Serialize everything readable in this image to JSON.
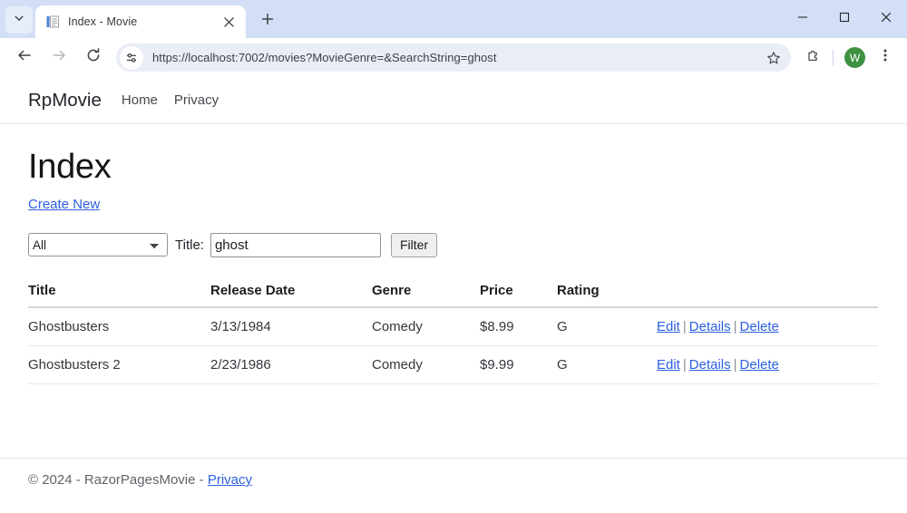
{
  "browser": {
    "tab": {
      "title": "Index - Movie",
      "favicon_icon": "document-icon",
      "close_icon": "close-icon"
    },
    "tablist_dropdown_icon": "chevron-down-icon",
    "new_tab_icon": "plus-icon",
    "window_controls": {
      "minimize_icon": "minimize-icon",
      "maximize_icon": "maximize-icon",
      "close_icon": "close-icon"
    },
    "toolbar": {
      "back_icon": "arrow-left-icon",
      "forward_icon": "arrow-right-icon",
      "reload_icon": "reload-icon",
      "site_settings_icon": "tune-icon",
      "url": "https://localhost:7002/movies?MovieGenre=&SearchString=ghost",
      "bookmark_icon": "star-icon",
      "extensions_icon": "puzzle-piece-icon",
      "profile_initial": "W",
      "menu_icon": "three-dots-vertical-icon"
    }
  },
  "page": {
    "navbar": {
      "brand": "RpMovie",
      "links": [
        {
          "label": "Home"
        },
        {
          "label": "Privacy"
        }
      ]
    },
    "title": "Index",
    "create_new_label": "Create New",
    "filter": {
      "genre_selected": "All",
      "genre_options": [
        "All"
      ],
      "title_label": "Title:",
      "search_value": "ghost",
      "search_placeholder": "",
      "filter_button": "Filter"
    },
    "table": {
      "columns": [
        "Title",
        "Release Date",
        "Genre",
        "Price",
        "Rating"
      ],
      "actions": {
        "edit": "Edit",
        "details": "Details",
        "delete": "Delete",
        "separator": "|"
      },
      "rows": [
        {
          "title": "Ghostbusters",
          "release_date": "3/13/1984",
          "genre": "Comedy",
          "price": "$8.99",
          "rating": "G"
        },
        {
          "title": "Ghostbusters 2",
          "release_date": "2/23/1986",
          "genre": "Comedy",
          "price": "$9.99",
          "rating": "G"
        }
      ]
    },
    "footer": {
      "text": "© 2024 - RazorPagesMovie - ",
      "privacy_label": "Privacy"
    }
  },
  "colors": {
    "chrome_bg": "#d3dff7",
    "link": "#2c5fe0",
    "avatar_green": "#3f9142"
  }
}
